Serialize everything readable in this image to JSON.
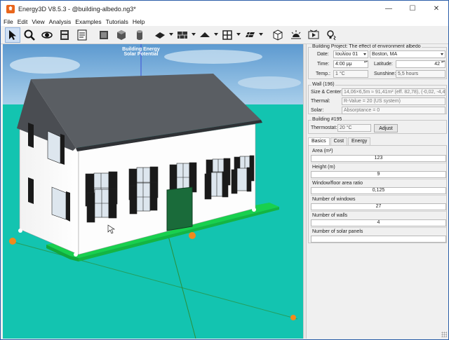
{
  "window": {
    "title": "Energy3D V8.5.3 - @building-albedo.ng3*",
    "controls": {
      "minimize": "—",
      "maximize": "☐",
      "close": "✕"
    }
  },
  "menu": [
    "File",
    "Edit",
    "View",
    "Analysis",
    "Examples",
    "Tutorials",
    "Help"
  ],
  "toolbar": {
    "tools": [
      "select-arrow-icon",
      "zoom-icon",
      "rotate-view-icon",
      "preview-icon",
      "note-icon",
      "foundation-icon",
      "box-icon",
      "cylinder-icon",
      "wall-icon",
      "brick-icon",
      "roof-icon",
      "window-grid-icon",
      "solar-panel-icon",
      "tree-icon",
      "sun-icon",
      "play-icon",
      "heliodon-icon"
    ]
  },
  "view": {
    "label_line1": "Building Energy",
    "label_line2": "Solar Potential",
    "colors": {
      "sky": "#7fb4de",
      "ground": "#13c4b0",
      "foundation": "#19d04e",
      "roof": "#5a5e63",
      "door": "#1a6b3a",
      "handle": "#f08a1c"
    }
  },
  "panel": {
    "project": {
      "group_title": "Building Project: The effect of environment albedo",
      "date_label": "Date:",
      "date_value": "Ιουλίου 01",
      "city_value": "Boston, MA",
      "time_label": "Time:",
      "time_value": "4:00 μμ",
      "latitude_label": "Latitude:",
      "latitude_value": "42",
      "temp_label": "Temp.:",
      "temp_value": "1 °C",
      "sunshine_label": "Sunshine:",
      "sunshine_value": "5,5 hours"
    },
    "wall": {
      "group_title": "Wall (196)",
      "size_label": "Size & Center:",
      "size_value": "14,06×6,5m ≈ 91,41m² (eff. 82,78), (-0,02, -4,42, 3,4",
      "thermal_label": "Thermal:",
      "thermal_value": "R-Value = 20 (US system)",
      "solar_label": "Solar:",
      "solar_value": "Absorptance = 0"
    },
    "building": {
      "group_title": "Building #195",
      "thermostat_label": "Thermostat:",
      "thermostat_value": "20 °C",
      "adjust_button": "Adjust"
    },
    "tabs": [
      "Basics",
      "Cost",
      "Energy"
    ],
    "basics": [
      {
        "label": "Area (m²)",
        "value": "123"
      },
      {
        "label": "Height (m)",
        "value": "9"
      },
      {
        "label": "Window/floor area ratio",
        "value": "0,125"
      },
      {
        "label": "Number of windows",
        "value": "27"
      },
      {
        "label": "Number of walls",
        "value": "4"
      },
      {
        "label": "Number of solar panels",
        "value": ""
      }
    ]
  }
}
